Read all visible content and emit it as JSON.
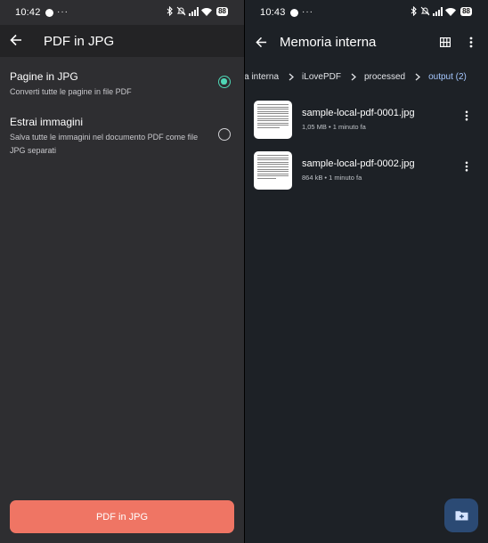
{
  "left": {
    "status": {
      "time": "10:42",
      "battery": "88"
    },
    "appbar": {
      "title": "PDF in JPG"
    },
    "options": [
      {
        "title": "Pagine in JPG",
        "description": "Converti tutte le pagine in file PDF",
        "selected": true
      },
      {
        "title": "Estrai immagini",
        "description": "Salva tutte le immagini nel documento PDF come file JPG separati",
        "selected": false
      }
    ],
    "convert_button": "PDF in JPG"
  },
  "right": {
    "status": {
      "time": "10:43",
      "battery": "88"
    },
    "appbar": {
      "title": "Memoria interna"
    },
    "breadcrumb": [
      "oria interna",
      "iLovePDF",
      "processed",
      "output (2)"
    ],
    "files": [
      {
        "name": "sample-local-pdf-0001.jpg",
        "meta": "1,05 MB • 1 minuto fa"
      },
      {
        "name": "sample-local-pdf-0002.jpg",
        "meta": "864 kB • 1 minuto fa"
      }
    ]
  },
  "colors": {
    "accent_radio": "#4fd6b5",
    "button": "#ef7564",
    "breadcrumb_current": "#a6c8ff",
    "fab": "#2b4a74"
  }
}
